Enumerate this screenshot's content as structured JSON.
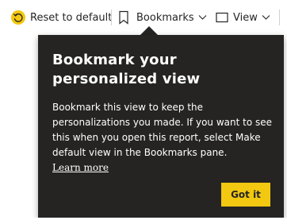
{
  "toolbar": {
    "reset_label": "Reset to default",
    "bookmarks_label": "Bookmarks",
    "view_label": "View",
    "reset_icon": "reset-arrow-icon",
    "bookmarks_icon": "bookmark-icon",
    "view_icon": "view-icon",
    "accent_color": "#f2c811"
  },
  "callout": {
    "title": "Bookmark your personalized view",
    "body": "Bookmark this view to keep the personalizations you made. If you want to see this when you open this report, select Make default view in the Bookmarks pane.",
    "link": "Learn more",
    "button": "Got it",
    "background_color": "#252423"
  }
}
